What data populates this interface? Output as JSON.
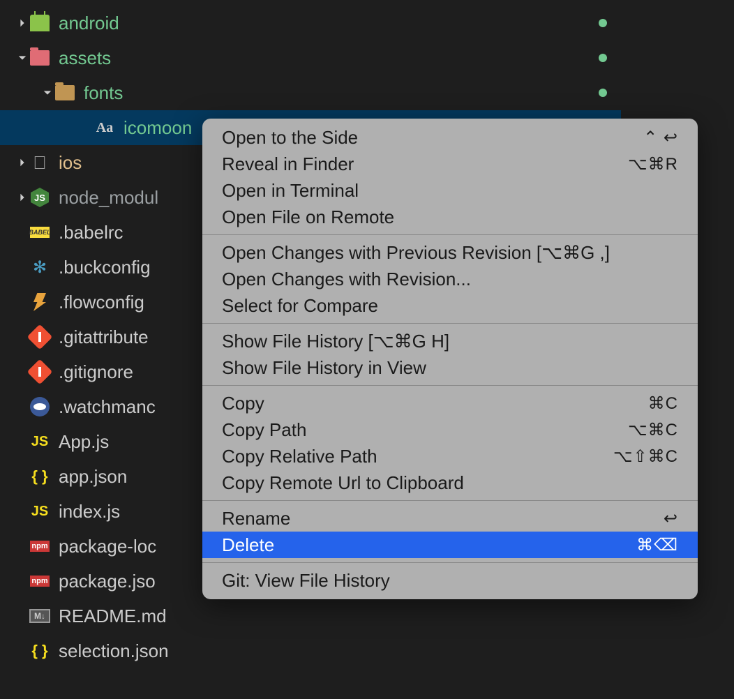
{
  "tree": {
    "items": [
      {
        "label": "android",
        "colorClass": "label-green",
        "hasDot": true,
        "expandable": true,
        "expanded": false,
        "indent": 0,
        "iconType": "android"
      },
      {
        "label": "assets",
        "colorClass": "label-green",
        "hasDot": true,
        "expandable": true,
        "expanded": true,
        "indent": 0,
        "iconType": "folder-red"
      },
      {
        "label": "fonts",
        "colorClass": "label-green",
        "hasDot": true,
        "expandable": true,
        "expanded": true,
        "indent": 1,
        "iconType": "folder"
      },
      {
        "label": "icomoon",
        "colorClass": "label-green",
        "hasDot": false,
        "expandable": false,
        "expanded": false,
        "indent": 2,
        "iconType": "font",
        "selected": true
      },
      {
        "label": "ios",
        "colorClass": "label-orange",
        "hasDot": false,
        "expandable": true,
        "expanded": false,
        "indent": 0,
        "iconType": "apple"
      },
      {
        "label": "node_modul",
        "colorClass": "label-gray",
        "hasDot": false,
        "expandable": true,
        "expanded": false,
        "indent": 0,
        "iconType": "nodejs"
      },
      {
        "label": ".babelrc",
        "colorClass": "label-white",
        "hasDot": false,
        "expandable": false,
        "expanded": false,
        "indent": 0,
        "iconType": "babel"
      },
      {
        "label": ".buckconfig",
        "colorClass": "label-white",
        "hasDot": false,
        "expandable": false,
        "expanded": false,
        "indent": 0,
        "iconType": "buck"
      },
      {
        "label": ".flowconfig",
        "colorClass": "label-white",
        "hasDot": false,
        "expandable": false,
        "expanded": false,
        "indent": 0,
        "iconType": "flow"
      },
      {
        "label": ".gitattribute",
        "colorClass": "label-white",
        "hasDot": false,
        "expandable": false,
        "expanded": false,
        "indent": 0,
        "iconType": "git"
      },
      {
        "label": ".gitignore",
        "colorClass": "label-white",
        "hasDot": false,
        "expandable": false,
        "expanded": false,
        "indent": 0,
        "iconType": "git"
      },
      {
        "label": ".watchmanc",
        "colorClass": "label-white",
        "hasDot": false,
        "expandable": false,
        "expanded": false,
        "indent": 0,
        "iconType": "eye"
      },
      {
        "label": "App.js",
        "colorClass": "label-white",
        "hasDot": false,
        "expandable": false,
        "expanded": false,
        "indent": 0,
        "iconType": "js"
      },
      {
        "label": "app.json",
        "colorClass": "label-white",
        "hasDot": false,
        "expandable": false,
        "expanded": false,
        "indent": 0,
        "iconType": "json"
      },
      {
        "label": "index.js",
        "colorClass": "label-white",
        "hasDot": false,
        "expandable": false,
        "expanded": false,
        "indent": 0,
        "iconType": "js"
      },
      {
        "label": "package-loc",
        "colorClass": "label-white",
        "hasDot": false,
        "expandable": false,
        "expanded": false,
        "indent": 0,
        "iconType": "npm"
      },
      {
        "label": "package.jso",
        "colorClass": "label-white",
        "hasDot": false,
        "expandable": false,
        "expanded": false,
        "indent": 0,
        "iconType": "npm"
      },
      {
        "label": "README.md",
        "colorClass": "label-white",
        "hasDot": false,
        "expandable": false,
        "expanded": false,
        "indent": 0,
        "iconType": "md"
      },
      {
        "label": "selection.json",
        "colorClass": "label-white",
        "hasDot": false,
        "expandable": false,
        "expanded": false,
        "indent": 0,
        "iconType": "json"
      }
    ]
  },
  "contextMenu": {
    "groups": [
      [
        {
          "label": "Open to the Side",
          "shortcut": "⌃ ↩"
        },
        {
          "label": "Reveal in Finder",
          "shortcut": "⌥⌘R"
        },
        {
          "label": "Open in Terminal",
          "shortcut": ""
        },
        {
          "label": "Open File on Remote",
          "shortcut": ""
        }
      ],
      [
        {
          "label": "Open Changes with Previous Revision [⌥⌘G ,]",
          "shortcut": ""
        },
        {
          "label": "Open Changes with Revision...",
          "shortcut": ""
        },
        {
          "label": "Select for Compare",
          "shortcut": ""
        }
      ],
      [
        {
          "label": "Show File History [⌥⌘G H]",
          "shortcut": ""
        },
        {
          "label": "Show File History in View",
          "shortcut": ""
        }
      ],
      [
        {
          "label": "Copy",
          "shortcut": "⌘C"
        },
        {
          "label": "Copy Path",
          "shortcut": "⌥⌘C"
        },
        {
          "label": "Copy Relative Path",
          "shortcut": "⌥⇧⌘C"
        },
        {
          "label": "Copy Remote Url to Clipboard",
          "shortcut": ""
        }
      ],
      [
        {
          "label": "Rename",
          "shortcut": "↩"
        },
        {
          "label": "Delete",
          "shortcut": "⌘⌫",
          "highlighted": true
        }
      ],
      [
        {
          "label": "Git: View File History",
          "shortcut": ""
        }
      ]
    ]
  }
}
